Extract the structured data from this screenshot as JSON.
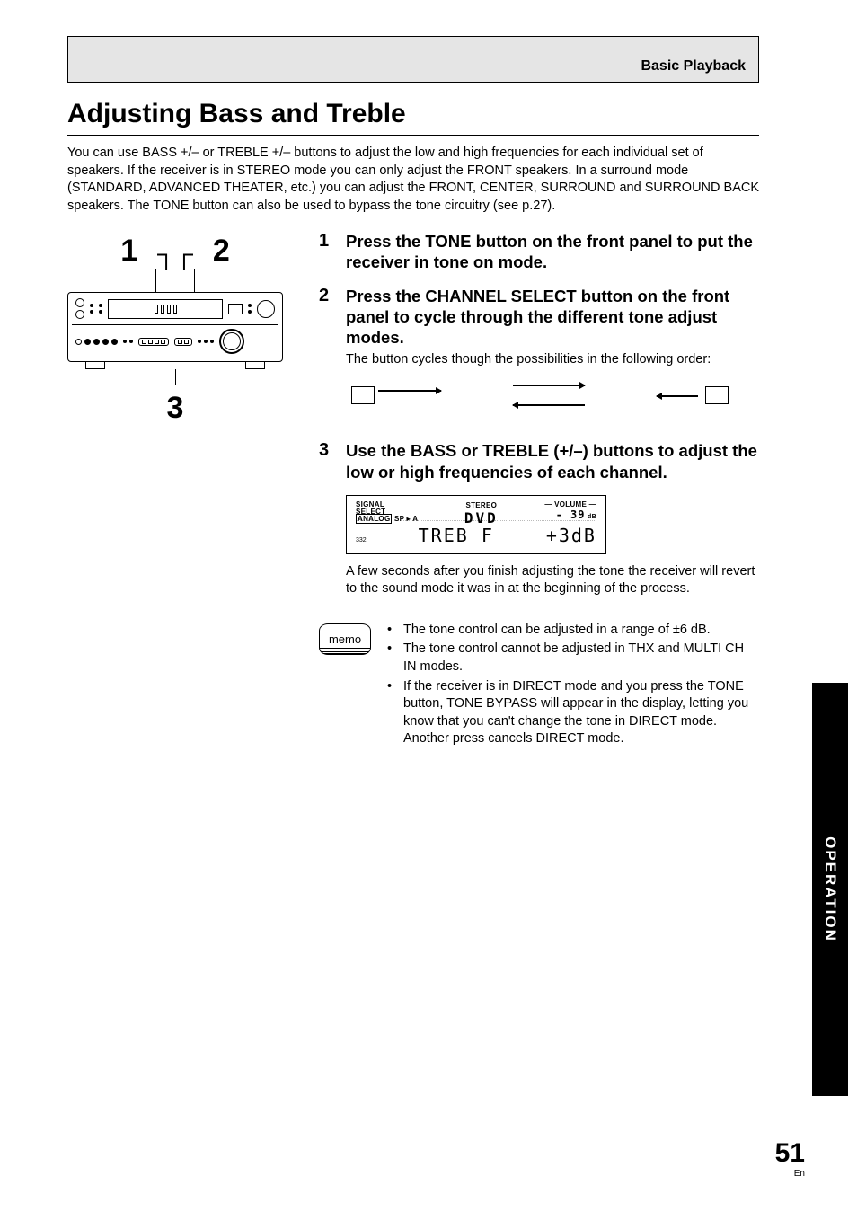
{
  "header": {
    "section": "Basic Playback"
  },
  "title": "Adjusting Bass and Treble",
  "intro": "You can use BASS +/– or TREBLE +/– buttons to adjust the low and high frequencies for each individual set of speakers. If the receiver is in STEREO mode you can only adjust the FRONT speakers. In a surround mode (STANDARD, ADVANCED THEATER, etc.) you can adjust the FRONT, CENTER, SURROUND and  SURROUND BACK speakers. The TONE button can also be used to bypass the tone circuitry (see p.27).",
  "diagram": {
    "c1": "1",
    "c2": "2",
    "c3": "3"
  },
  "steps": [
    {
      "num": "1",
      "head": "Press the TONE button on the front panel to put the receiver in tone on mode.",
      "text": ""
    },
    {
      "num": "2",
      "head": "Press the CHANNEL SELECT button on the front panel to cycle through the different tone adjust modes.",
      "text": "The button cycles though the possibilities in the following order:"
    },
    {
      "num": "3",
      "head": "Use the BASS or TREBLE (+/–) buttons to adjust the low or high frequencies of each channel.",
      "text_after": "A few seconds after you finish adjusting the tone the receiver will revert to the sound mode it was in at the beginning of the process."
    }
  ],
  "lcd": {
    "signal1": "SIGNAL",
    "signal2": "SELECT",
    "analog": "ANALOG",
    "sp": "SP ▸ A",
    "stereo": "STEREO",
    "source": "DVD",
    "vol_label": "—  VOLUME  —",
    "vol_val": "- 39",
    "vol_unit": "dB",
    "line2_left": "TREB  F",
    "line2_right": "+3dB",
    "tiny": "332"
  },
  "memo": {
    "label": "memo",
    "items": [
      "The tone control can be adjusted in a range of ±6 dB.",
      "The tone control cannot be adjusted in THX and MULTI CH IN modes.",
      "If the receiver is in DIRECT mode and you press the TONE button, TONE BYPASS will appear in the display, letting you know that you can't change the tone in DIRECT mode. Another press cancels DIRECT mode."
    ]
  },
  "sidetab": "OPERATION",
  "page": {
    "num": "51",
    "lang": "En"
  }
}
